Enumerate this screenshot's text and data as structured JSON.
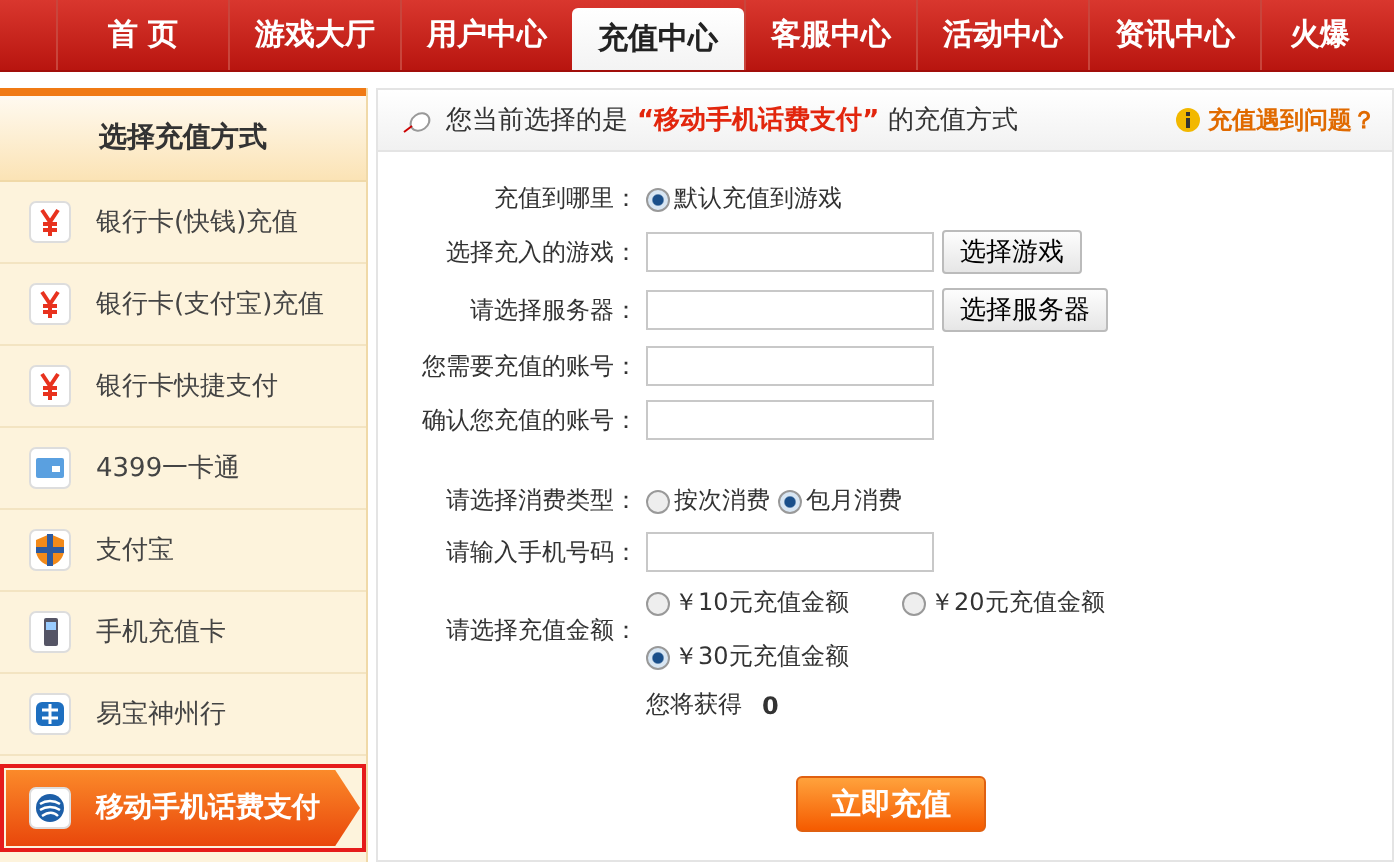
{
  "nav": {
    "tabs": [
      {
        "label": "首 页",
        "selected": false
      },
      {
        "label": "游戏大厅",
        "selected": false
      },
      {
        "label": "用户中心",
        "selected": false
      },
      {
        "label": "充值中心",
        "selected": true
      },
      {
        "label": "客服中心",
        "selected": false
      },
      {
        "label": "活动中心",
        "selected": false
      },
      {
        "label": "资讯中心",
        "selected": false
      },
      {
        "label": "火爆",
        "selected": false
      }
    ]
  },
  "sidebar": {
    "title": "选择充值方式",
    "items": [
      {
        "label": "银行卡(快钱)充值",
        "selected": false
      },
      {
        "label": "银行卡(支付宝)充值",
        "selected": false
      },
      {
        "label": "银行卡快捷支付",
        "selected": false
      },
      {
        "label": "4399一卡通",
        "selected": false
      },
      {
        "label": "支付宝",
        "selected": false
      },
      {
        "label": "手机充值卡",
        "selected": false
      },
      {
        "label": "易宝神州行",
        "selected": false
      },
      {
        "label": "移动手机话费支付",
        "selected": true
      }
    ]
  },
  "header": {
    "prefix": "您当前选择的是",
    "method": "“移动手机话费支付”",
    "suffix": "的充值方式",
    "help_link": "充值遇到问题？"
  },
  "form": {
    "target": {
      "label": "充值到哪里：",
      "options": [
        {
          "label": "默认充值到游戏",
          "selected": true
        }
      ]
    },
    "fields": [
      {
        "label": "选择充入的游戏：",
        "button": "选择游戏"
      },
      {
        "label": "请选择服务器：",
        "button": "选择服务器"
      },
      {
        "label": "您需要充值的账号："
      },
      {
        "label": "确认您充值的账号："
      }
    ],
    "consumption": {
      "label": "请选择消费类型：",
      "options": [
        {
          "label": "按次消费",
          "selected": false
        },
        {
          "label": "包月消费",
          "selected": true
        }
      ]
    },
    "phone": {
      "label": "请输入手机号码："
    },
    "amount": {
      "label": "请选择充值金额：",
      "options": [
        {
          "label": "￥10元充值金额",
          "selected": false
        },
        {
          "label": "￥20元充值金额",
          "selected": false
        },
        {
          "label": "￥30元充值金额",
          "selected": true
        }
      ]
    },
    "gain": {
      "label": "您将获得",
      "value": "0"
    },
    "submit": "立即充值"
  }
}
